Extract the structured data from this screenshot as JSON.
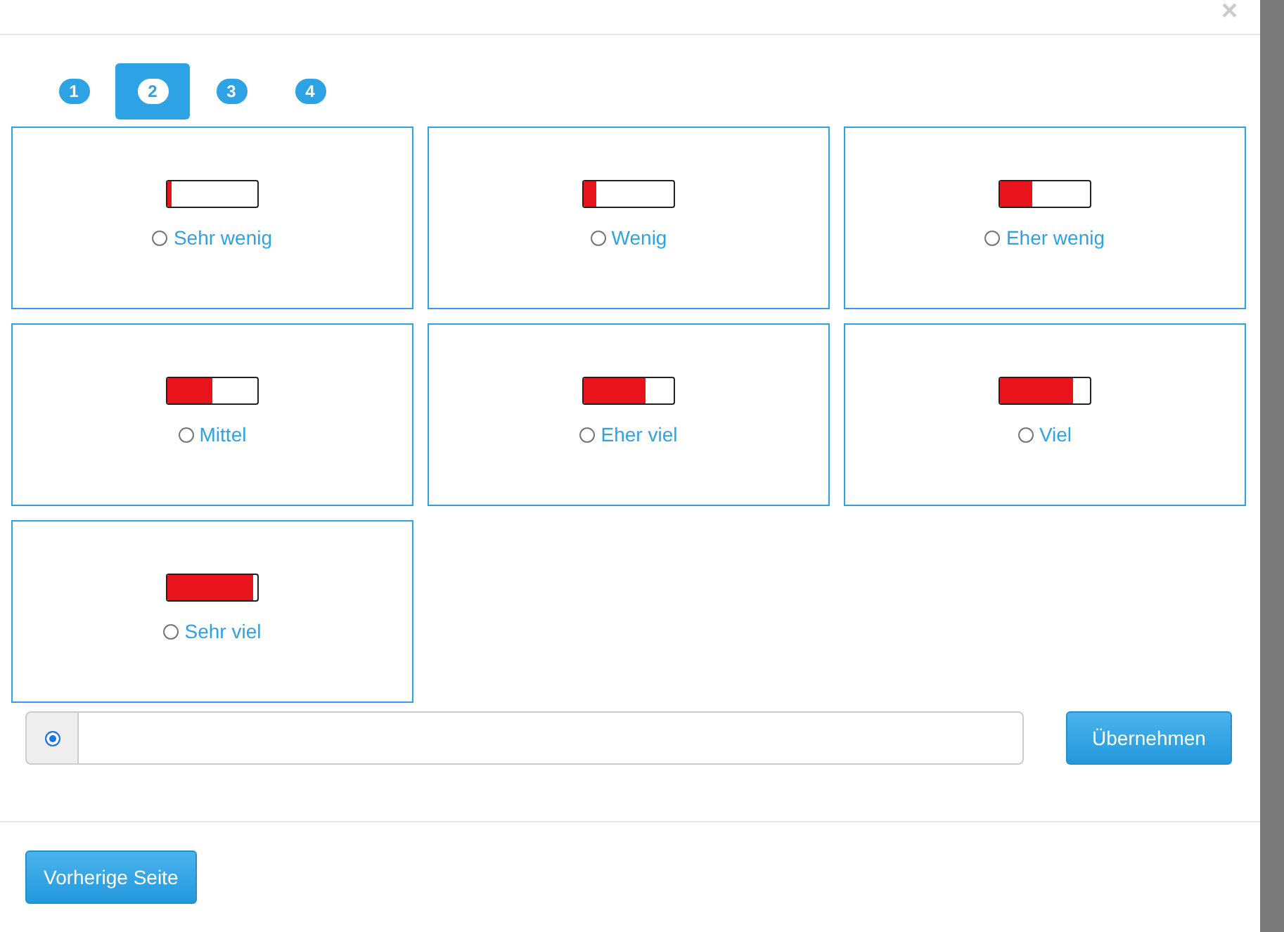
{
  "close": "×",
  "steps": [
    {
      "label": "1",
      "selected": false
    },
    {
      "label": "2",
      "selected": true
    },
    {
      "label": "3",
      "selected": false
    },
    {
      "label": "4",
      "selected": false
    }
  ],
  "options": [
    {
      "label": "Sehr wenig",
      "level": 0.05,
      "selected": false
    },
    {
      "label": "Wenig",
      "level": 0.14,
      "selected": false
    },
    {
      "label": "Eher wenig",
      "level": 0.36,
      "selected": false
    },
    {
      "label": "Mittel",
      "level": 0.5,
      "selected": false
    },
    {
      "label": "Eher viel",
      "level": 0.69,
      "selected": false
    },
    {
      "label": "Viel",
      "level": 0.82,
      "selected": false
    },
    {
      "label": "Sehr viel",
      "level": 0.95,
      "selected": false
    }
  ],
  "custom": {
    "selected": true
  },
  "apply_button": "Übernehmen",
  "back_button": "Vorherige Seite"
}
